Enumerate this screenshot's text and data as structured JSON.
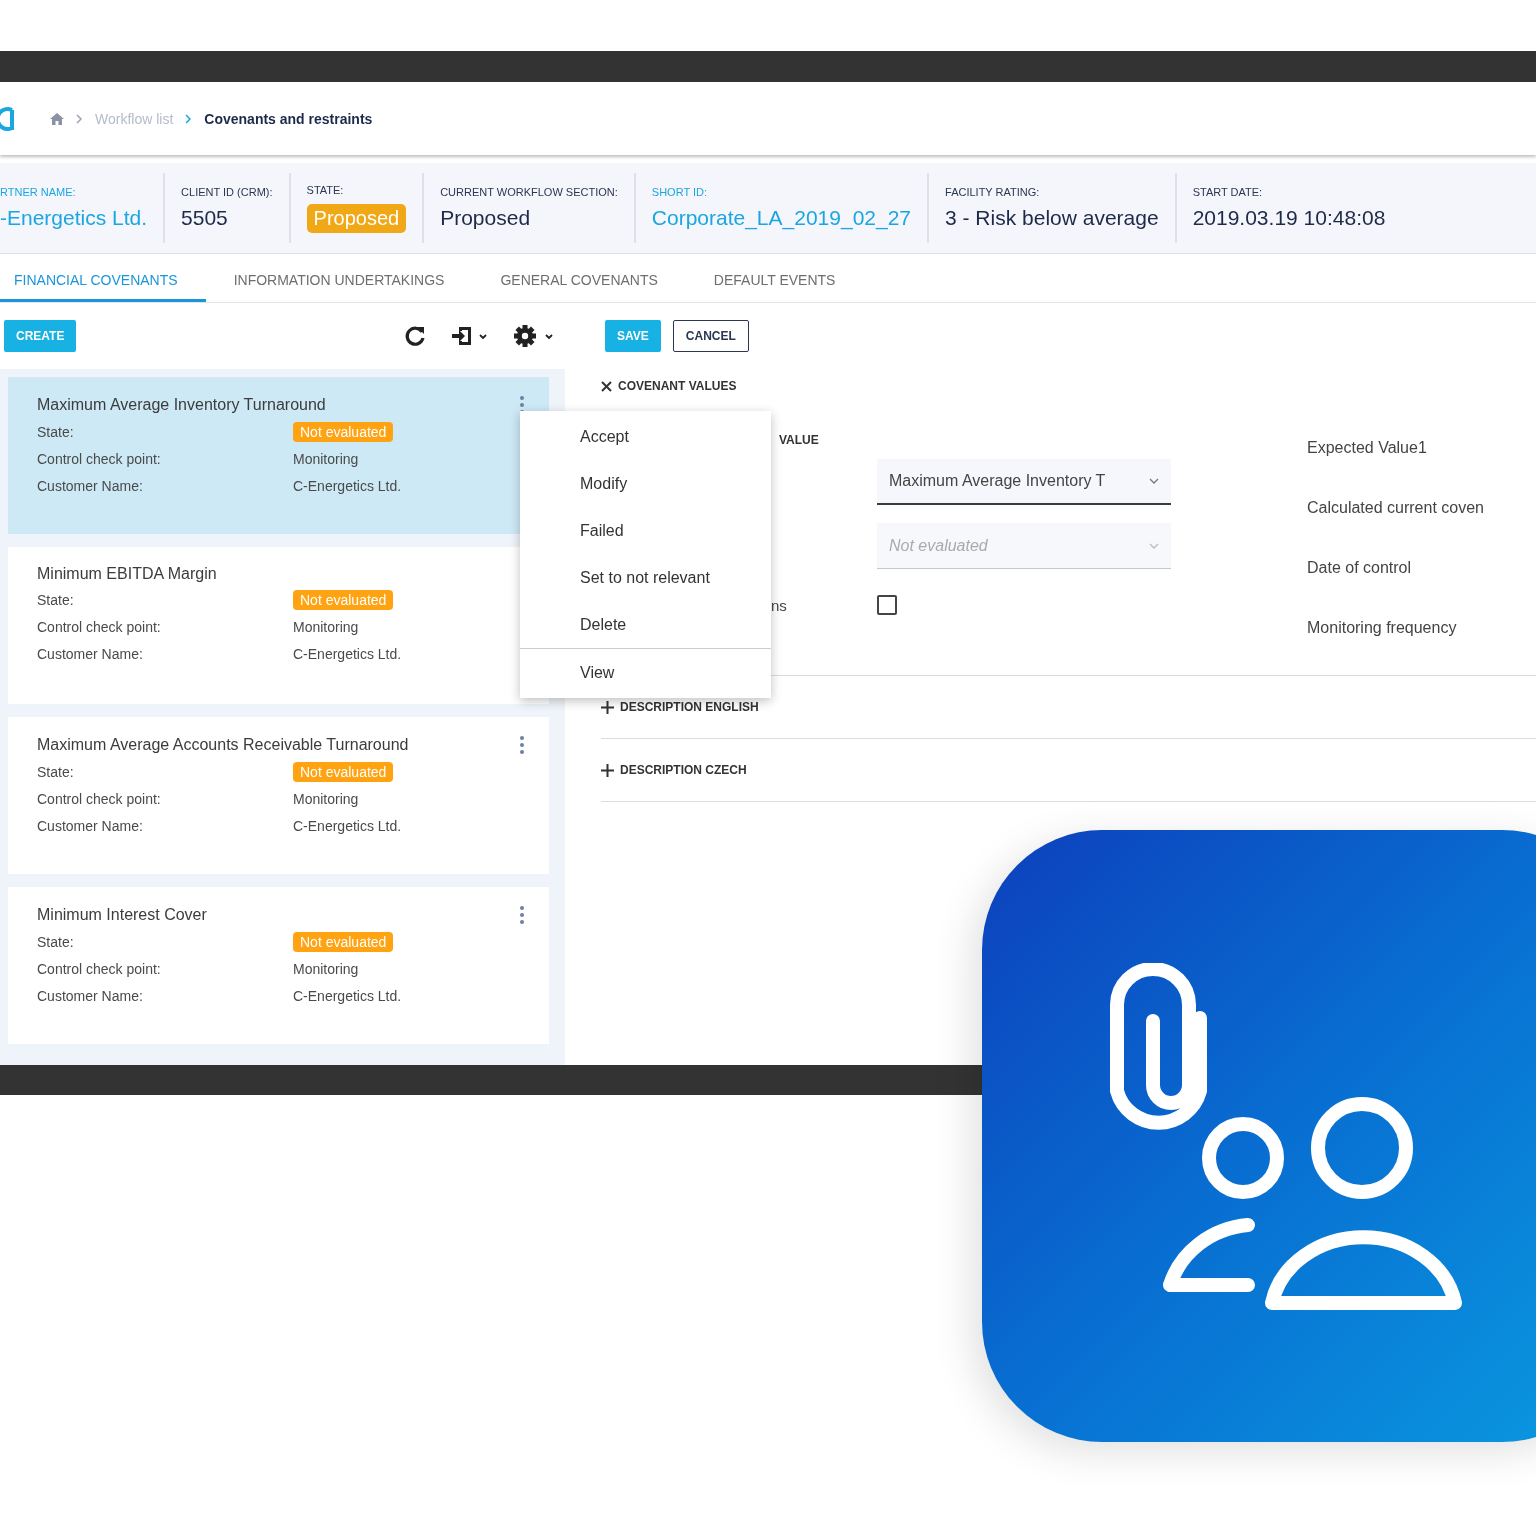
{
  "breadcrumb": [
    {
      "label": "Workflow list",
      "current": false
    },
    {
      "label": "Covenants and restraints",
      "current": true
    }
  ],
  "header_fields": [
    {
      "label": "RTNER NAME:",
      "value": "-Energetics Ltd.",
      "kind": "link"
    },
    {
      "label": "CLIENT ID (CRM):",
      "value": "5505",
      "kind": "text"
    },
    {
      "label": "STATE:",
      "value": "Proposed",
      "kind": "badge"
    },
    {
      "label": "CURRENT WORKFLOW SECTION:",
      "value": "Proposed",
      "kind": "text"
    },
    {
      "label": "SHORT ID:",
      "value": "Corporate_LA_2019_02_27",
      "kind": "link"
    },
    {
      "label": "FACILITY RATING:",
      "value": "3 - Risk below average",
      "kind": "text"
    },
    {
      "label": "START DATE:",
      "value": "2019.03.19 10:48:08",
      "kind": "text"
    }
  ],
  "tabs": [
    {
      "label": "FINANCIAL COVENANTS",
      "selected": true
    },
    {
      "label": "INFORMATION UNDERTAKINGS",
      "selected": false
    },
    {
      "label": "GENERAL COVENANTS",
      "selected": false
    },
    {
      "label": "DEFAULT EVENTS",
      "selected": false
    }
  ],
  "toolbar": {
    "create": "CREATE",
    "save": "SAVE",
    "cancel": "CANCEL"
  },
  "covenants": [
    {
      "title": "Maximum Average Inventory Turnaround",
      "selected": true,
      "more_icon": true,
      "fields": [
        {
          "label": "State:",
          "value": "Not evaluated",
          "kind": "badge"
        },
        {
          "label": "Control check point:",
          "value": "Monitoring",
          "kind": "text"
        },
        {
          "label": "Customer Name:",
          "value": "C-Energetics Ltd.",
          "kind": "text"
        }
      ]
    },
    {
      "title": "Minimum EBITDA Margin",
      "selected": false,
      "more_icon": false,
      "fields": [
        {
          "label": "State:",
          "value": "Not evaluated",
          "kind": "badge"
        },
        {
          "label": "Control check point:",
          "value": "Monitoring",
          "kind": "text"
        },
        {
          "label": "Customer Name:",
          "value": "C-Energetics Ltd.",
          "kind": "text"
        }
      ]
    },
    {
      "title": "Maximum Average Accounts Receivable Turnaround",
      "selected": false,
      "more_icon": true,
      "fields": [
        {
          "label": "State:",
          "value": "Not evaluated",
          "kind": "badge"
        },
        {
          "label": "Control check point:",
          "value": "Monitoring",
          "kind": "text"
        },
        {
          "label": "Customer Name:",
          "value": "C-Energetics Ltd.",
          "kind": "text"
        }
      ]
    },
    {
      "title": "Minimum Interest Cover",
      "selected": false,
      "more_icon": true,
      "fields": [
        {
          "label": "State:",
          "value": "Not evaluated",
          "kind": "badge"
        },
        {
          "label": "Control check point:",
          "value": "Monitoring",
          "kind": "text"
        },
        {
          "label": "Customer Name:",
          "value": "C-Energetics Ltd.",
          "kind": "text"
        }
      ]
    }
  ],
  "context_menu": [
    {
      "label": "Accept",
      "separated": false
    },
    {
      "label": "Modify",
      "separated": false
    },
    {
      "label": "Failed",
      "separated": false
    },
    {
      "label": "Set to not relevant",
      "separated": false
    },
    {
      "label": "Delete",
      "separated": false
    },
    {
      "label": "View",
      "separated": true
    }
  ],
  "covenant_values": {
    "title": "COVENANT VALUES",
    "expanded": true,
    "value_label": "VALUE",
    "covenant_select": {
      "value": "Maximum Average Inventory T",
      "disabled": false
    },
    "state_select": {
      "value": "Not evaluated",
      "disabled": true
    },
    "checkbox_label": "ns",
    "checked": false,
    "right_labels": [
      "Expected Value1",
      "Calculated current coven",
      "Date of control",
      "Monitoring frequency"
    ]
  },
  "sections": [
    {
      "title": "DESCRIPTION ENGLISH"
    },
    {
      "title": "DESCRIPTION CZECH"
    }
  ]
}
